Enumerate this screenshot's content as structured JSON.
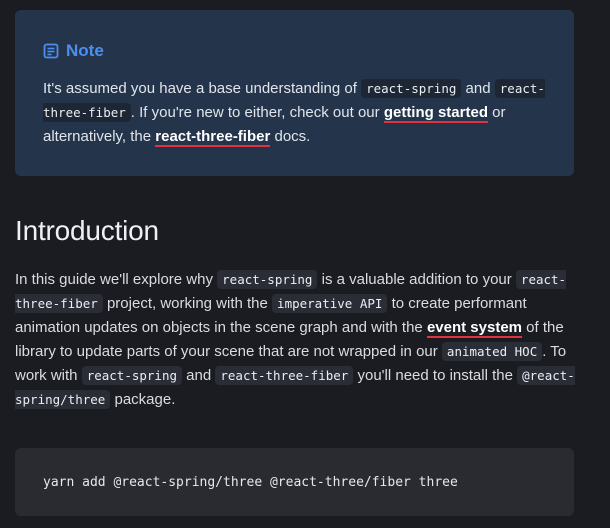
{
  "note": {
    "title": "Note",
    "icon": "note-icon",
    "text_1": "It's assumed you have a base understanding of ",
    "code_1": "react-spring",
    "text_2": " and ",
    "code_2": "react-three-fiber",
    "text_3": ". If you're new to either, check out our ",
    "link_1": "getting started",
    "text_4": " or alternatively, the ",
    "link_2": "react-three-fiber",
    "text_5": " docs."
  },
  "heading": "Introduction",
  "intro": {
    "t1": "In this guide we'll explore why ",
    "c1": "react-spring",
    "t2": " is a valuable addition to your ",
    "c2": "react-three-fiber",
    "t3": " project, working with the ",
    "c3": "imperative API",
    "t4": " to create performant animation updates on objects in the scene graph and with the ",
    "l1": "event system",
    "t5": " of the library to update parts of your scene that are not wrapped in our ",
    "c4": "animated HOC",
    "t6": ". To work with ",
    "c5": "react-spring",
    "t7": " and ",
    "c6": "react-three-fiber",
    "t8": " you'll need to install the ",
    "c7": "@react-spring/three",
    "t9": " package."
  },
  "code_block": {
    "command": "yarn add @react-spring/three @react-three/fiber three"
  },
  "colors": {
    "background": "#1b1c22",
    "note_background": "#24344b",
    "note_accent": "#4d8ff0",
    "link_underline": "#e0333f",
    "code_background": "#2a2d35"
  }
}
